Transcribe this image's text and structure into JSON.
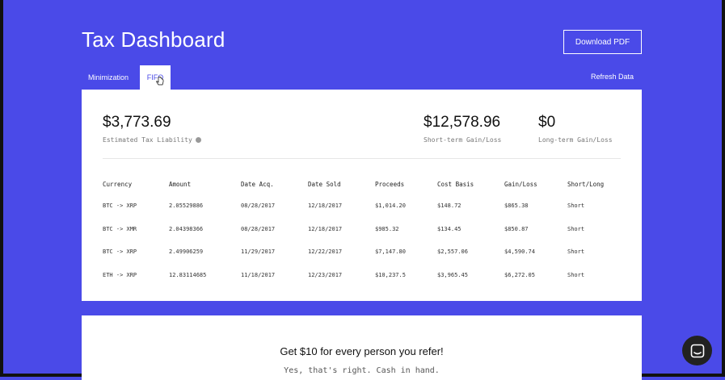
{
  "header": {
    "title": "Tax Dashboard",
    "download_label": "Download PDF"
  },
  "tabs": [
    {
      "label": "Minimization",
      "active": false
    },
    {
      "label": "FIFO",
      "active": true
    }
  ],
  "refresh_label": "Refresh Data",
  "summary": {
    "liability": {
      "value": "$3,773.69",
      "label": "Estimated Tax Liability"
    },
    "short_term": {
      "value": "$12,578.96",
      "label": "Short-term Gain/Loss"
    },
    "long_term": {
      "value": "$0",
      "label": "Long-term Gain/Loss"
    }
  },
  "table": {
    "headers": [
      "Currency",
      "Amount",
      "Date Acq.",
      "Date Sold",
      "Proceeds",
      "Cost Basis",
      "Gain/Loss",
      "Short/Long"
    ],
    "rows": [
      [
        "BTC -> XRP",
        "2.05529886",
        "08/28/2017",
        "12/18/2017",
        "$1,014.20",
        "$148.72",
        "$865.38",
        "Short"
      ],
      [
        "BTC -> XMR",
        "2.04398366",
        "08/28/2017",
        "12/18/2017",
        "$985.32",
        "$134.45",
        "$850.87",
        "Short"
      ],
      [
        "BTC -> XRP",
        "2.49906259",
        "11/29/2017",
        "12/22/2017",
        "$7,147.80",
        "$2,557.06",
        "$4,590.74",
        "Short"
      ],
      [
        "ETH -> XRP",
        "12.83114685",
        "11/18/2017",
        "12/23/2017",
        "$10,237.5",
        "$3,965.45",
        "$6,272.05",
        "Short"
      ]
    ]
  },
  "referral": {
    "title": "Get $10 for every person you refer!",
    "subtitle": "Yes, that's right. Cash in hand."
  },
  "colors": {
    "background": "#4a4ae8",
    "card": "#ffffff",
    "chat_button": "#222222"
  },
  "icons": {
    "info": "info-icon",
    "chat": "chat-icon",
    "cursor": "hand-pointer-icon"
  }
}
